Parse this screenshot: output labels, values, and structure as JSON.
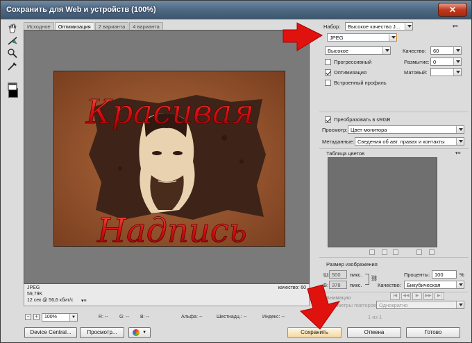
{
  "window": {
    "title": "Сохранить для Web и устройств (100%)",
    "close_glyph": "✕"
  },
  "tabs": [
    "Исходное",
    "Оптимизация",
    "2 варианта",
    "4 варианта"
  ],
  "image_text": {
    "top": "Красивая",
    "bottom": "Надпись"
  },
  "info": {
    "format": "JPEG",
    "size": "59,79K",
    "time": "12 сек @ 56,6 кбит/с",
    "menu": "▾≡",
    "quality": "качество: 60"
  },
  "zoom": {
    "minus": "−",
    "plus": "+",
    "value": "100%"
  },
  "readouts": {
    "r": "R: --",
    "g": "G: --",
    "b": "B: --",
    "alpha": "Альфа: --",
    "hex": "Шестнадц.: --",
    "index": "Индекс: --"
  },
  "buttons": {
    "device_central": "Device Central...",
    "preview": "Просмотр...",
    "save": "Сохранить",
    "cancel": "Отмена",
    "done": "Готово"
  },
  "settings": {
    "preset_label": "Набор:",
    "preset_value": "Высокое качество J...",
    "format_value": "JPEG",
    "quality_level": "Высокое",
    "quality_label": "Качество:",
    "quality_value": "60",
    "progressive_label": "Прогрессивный",
    "blur_label": "Размытие:",
    "blur_value": "0",
    "optimized_label": "Оптимизация",
    "matte_label": "Матовый:",
    "icc_label": "Встроенный профиль",
    "srgb_label": "Преобразовать в sRGB",
    "preview_label": "Просмотр:",
    "preview_value": "Цвет монитора",
    "metadata_label": "Метаданные:",
    "metadata_value": "Сведения об авт. правах и контакты",
    "color_table_label": "Таблица цветов"
  },
  "image_size": {
    "heading": "Размер изображения",
    "w_label": "Ш:",
    "w_value": "500",
    "h_label": "В:",
    "h_value": "378",
    "unit": "пикс.",
    "percent_label": "Проценты:",
    "percent_value": "100",
    "percent_sign": "%",
    "quality_label": "Качество:",
    "quality_value": "Бикубическая"
  },
  "animation": {
    "heading": "Анимация",
    "loop_label": "Параметры повторов:",
    "loop_value": "Однократно",
    "frame": "1 из 1"
  },
  "colors": {
    "arrow": "#e0120e",
    "title_bar": "#4f6a84",
    "photo_bg": "#8a4a28",
    "text_red": "#d40f12"
  }
}
